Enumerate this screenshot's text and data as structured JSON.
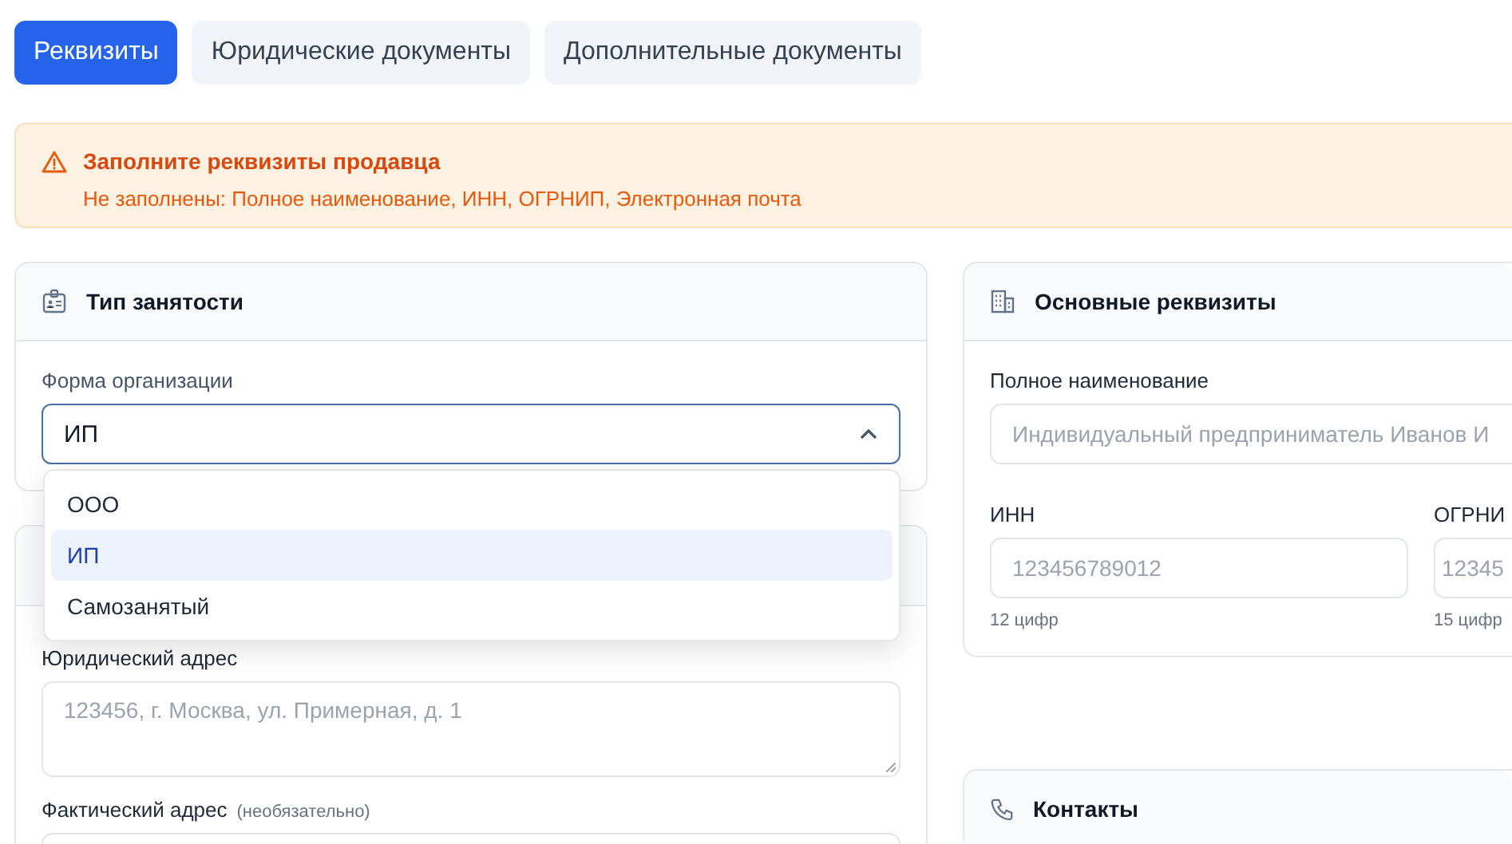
{
  "tabs": [
    {
      "label": "Реквизиты",
      "selected": true
    },
    {
      "label": "Юридические документы",
      "selected": false
    },
    {
      "label": "Дополнительные документы",
      "selected": false
    }
  ],
  "alert": {
    "title": "Заполните реквизиты продавца",
    "message": "Не заполнены: Полное наименование, ИНН, ОГРНИП, Электронная почта"
  },
  "employment_card": {
    "title": "Тип занятости",
    "field": {
      "label": "Форма организации",
      "value": "ИП",
      "expanded": true,
      "options": [
        {
          "label": "ООО",
          "selected": false
        },
        {
          "label": "ИП",
          "selected": true
        },
        {
          "label": "Самозанятый",
          "selected": false
        }
      ]
    }
  },
  "address_card": {
    "fields": [
      {
        "label": "Юридический адрес",
        "placeholder": "123456, г. Москва, ул. Примерная, д. 1"
      },
      {
        "label": "Фактический адрес",
        "note": "(необязательно)"
      }
    ]
  },
  "requisites_card": {
    "title": "Основные реквизиты",
    "full_name": {
      "label": "Полное наименование",
      "placeholder": "Индивидуальный предприниматель Иванов И"
    },
    "fields": [
      {
        "label": "ИНН",
        "placeholder": "123456789012",
        "hint": "12 цифр"
      },
      {
        "label": "ОГРНИ",
        "placeholder": "12345",
        "hint": "15 цифр"
      }
    ]
  },
  "contacts_card": {
    "title": "Контакты"
  }
}
